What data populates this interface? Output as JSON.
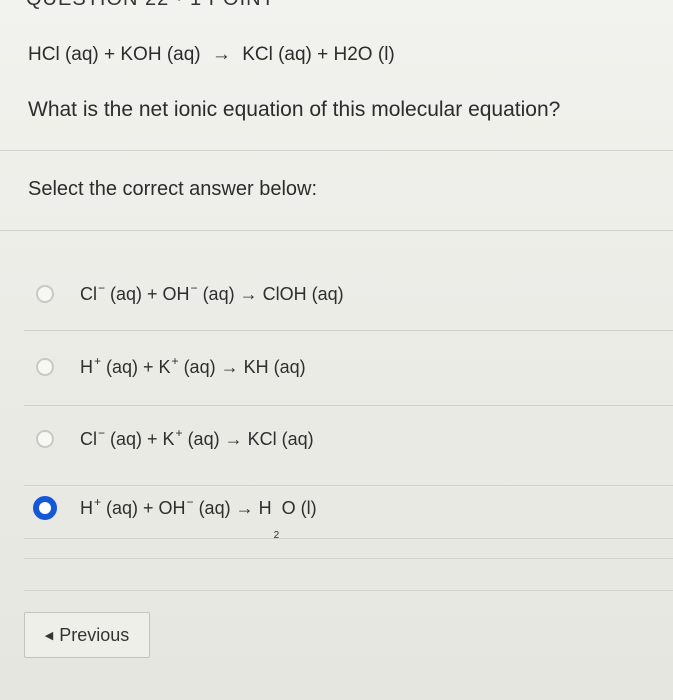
{
  "header": {
    "label": "QUESTION 22 · 1 POINT"
  },
  "equation": {
    "left": "HCl (aq) + KOH (aq)",
    "arrow": "→",
    "right": "KCl (aq) + H2O (l)"
  },
  "question_text": "What is the net ionic equation of this molecular equation?",
  "prompt": "Select the correct answer below:",
  "options": [
    {
      "p1": "Cl",
      "s1": "−",
      "p2": " (aq) + OH",
      "s2": "−",
      "p3": " (aq) → ClOH (aq)",
      "selected": false
    },
    {
      "p1": "H",
      "s1": "+",
      "p2": " (aq) + K",
      "s2": "+",
      "p3": " (aq) → KH (aq)",
      "selected": false
    },
    {
      "p1": "Cl",
      "s1": "−",
      "p2": " (aq) + K",
      "s2": "+",
      "p3": " (aq) → KCl (aq)",
      "selected": false
    },
    {
      "p1": "H",
      "s1": "+",
      "p2": " (aq) + OH",
      "s2": "−",
      "p3": " (aq) → H",
      "p4": "O (l)",
      "sub": "2",
      "selected": true
    }
  ],
  "previous_button": {
    "icon": "chevron-left-icon",
    "label": "Previous"
  },
  "colors": {
    "accent": "#1458d8",
    "background": "#ecece7",
    "text": "#2c2c2c"
  }
}
